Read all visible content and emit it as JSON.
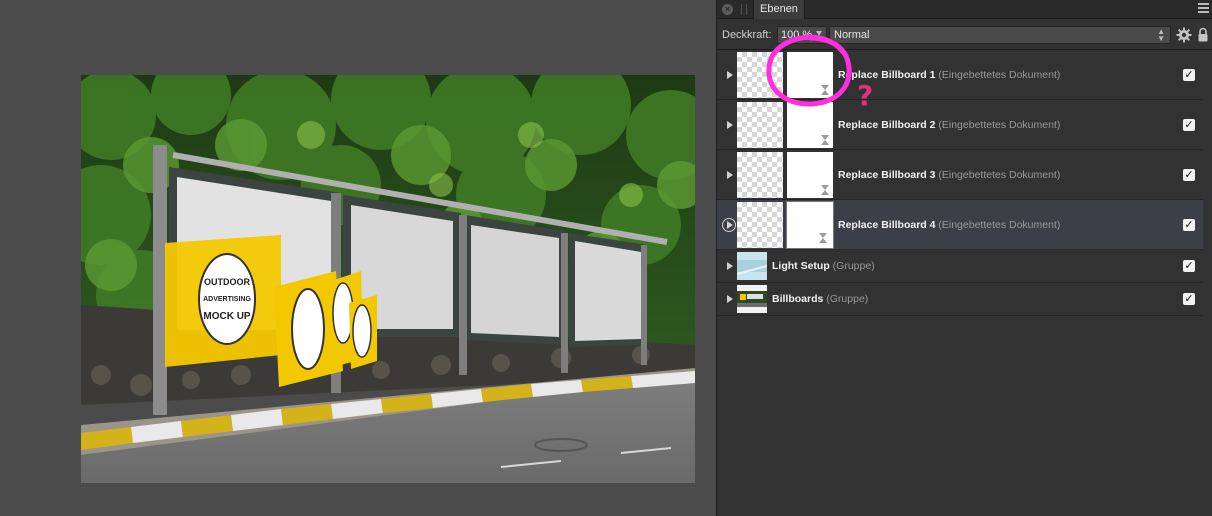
{
  "panel": {
    "tab_label": "Ebenen",
    "opacity_label": "Deckkraft:",
    "opacity_value": "100 %",
    "blend_mode": "Normal"
  },
  "layers": [
    {
      "name": "Replace Billboard 1",
      "type": "(Eingebettetes Dokument)",
      "visible": true,
      "selected": false
    },
    {
      "name": "Replace Billboard 2",
      "type": "(Eingebettetes Dokument)",
      "visible": true,
      "selected": false
    },
    {
      "name": "Replace Billboard 3",
      "type": "(Eingebettetes Dokument)",
      "visible": true,
      "selected": false
    },
    {
      "name": "Replace Billboard 4",
      "type": "(Eingebettetes Dokument)",
      "visible": true,
      "selected": true
    },
    {
      "name": "Light Setup",
      "type": "(Gruppe)",
      "visible": true,
      "selected": false
    },
    {
      "name": "Billboards",
      "type": "(Gruppe)",
      "visible": true,
      "selected": false
    }
  ],
  "checkmark": "✓",
  "annotation": {
    "mark": "?",
    "color": "#e0337c",
    "circle_color": "#ff2fe0"
  },
  "poster": {
    "line1": "OUTDOOR",
    "line2": "ADVERTISING",
    "line3": "MOCK UP",
    "color": "#f4c800"
  },
  "colors": {
    "canvas_bg": "#4b4b4b",
    "panel_bg": "#323232",
    "selected_row": "#3b3f48"
  },
  "icons": {
    "settings": "gear-icon",
    "lock": "lock-icon",
    "menu": "hamburger-menu-icon",
    "close": "close-icon"
  }
}
